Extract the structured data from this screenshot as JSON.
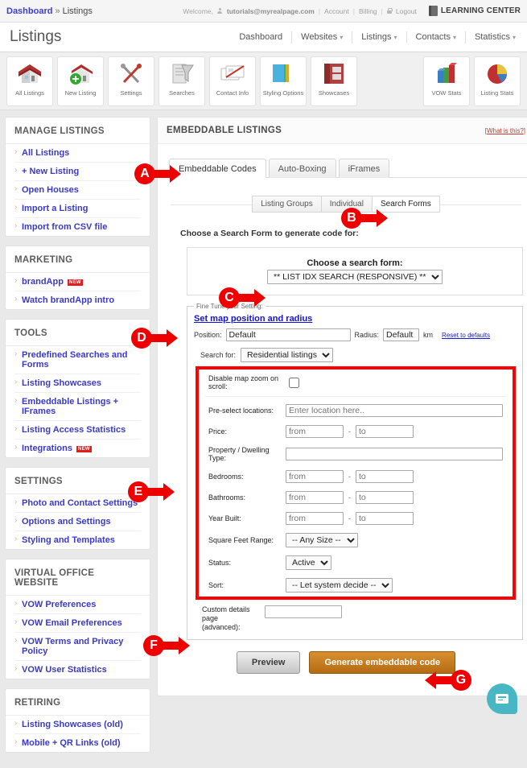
{
  "topbar": {
    "breadcrumb_link": "Dashboard",
    "breadcrumb_sep": "»",
    "breadcrumb_current": "Listings",
    "welcome_label": "Welcome,",
    "email": "tutorials@myrealpage.com",
    "account_link": "Account",
    "billing_link": "Billing",
    "logout_link": "Logout",
    "learning_center": "LEARNING CENTER",
    "divider": "|"
  },
  "titlebar": {
    "page_title": "Listings",
    "nav": [
      {
        "label": "Dashboard",
        "caret": ""
      },
      {
        "label": "Websites",
        "caret": "▾"
      },
      {
        "label": "Listings",
        "caret": "▾"
      },
      {
        "label": "Contacts",
        "caret": "▾"
      },
      {
        "label": "Statistics",
        "caret": "▾"
      }
    ]
  },
  "icontoolbar": {
    "left": [
      {
        "label": "All Listings",
        "icon": "house-icon"
      },
      {
        "label": "New Listing",
        "icon": "house-plus-icon"
      },
      {
        "label": "Settings",
        "icon": "tools-icon"
      },
      {
        "label": "Searches",
        "icon": "funnel-document-icon"
      },
      {
        "label": "Contact Info",
        "icon": "business-cards-icon"
      },
      {
        "label": "Styling Options",
        "icon": "color-books-icon"
      },
      {
        "label": "Showcases",
        "icon": "showcase-book-icon"
      }
    ],
    "right": [
      {
        "label": "VOW Stats",
        "icon": "bar-chart-icon"
      },
      {
        "label": "Listing Stats",
        "icon": "pie-chart-icon"
      }
    ]
  },
  "sidebar": {
    "sections": [
      {
        "title": "MANAGE LISTINGS",
        "items": [
          {
            "label": "All Listings",
            "new": false
          },
          {
            "label": "+ New Listing",
            "new": false
          },
          {
            "label": "Open Houses",
            "new": false
          },
          {
            "label": "Import a Listing",
            "new": false
          },
          {
            "label": "Import from CSV file",
            "new": false
          }
        ]
      },
      {
        "title": "MARKETING",
        "items": [
          {
            "label": "brandApp",
            "new": true,
            "new_label": "NEW"
          },
          {
            "label": "Watch brandApp intro",
            "new": false
          }
        ]
      },
      {
        "title": "TOOLS",
        "items": [
          {
            "label": "Predefined Searches and Forms",
            "new": false
          },
          {
            "label": "Listing Showcases",
            "new": false
          },
          {
            "label": "Embeddable Listings + IFrames",
            "new": false
          },
          {
            "label": "Listing Access Statistics",
            "new": false
          },
          {
            "label": "Integrations",
            "new": true,
            "new_label": "NEW"
          }
        ]
      },
      {
        "title": "SETTINGS",
        "items": [
          {
            "label": "Photo and Contact Settings",
            "new": false
          },
          {
            "label": "Options and Settings",
            "new": false
          },
          {
            "label": "Styling and Templates",
            "new": false
          }
        ]
      },
      {
        "title": "VIRTUAL OFFICE WEBSITE",
        "items": [
          {
            "label": "VOW Preferences",
            "new": false
          },
          {
            "label": "VOW Email Preferences",
            "new": false
          },
          {
            "label": "VOW Terms and Privacy Policy",
            "new": false
          },
          {
            "label": "VOW User Statistics",
            "new": false
          }
        ]
      },
      {
        "title": "RETIRING",
        "items": [
          {
            "label": "Listing Showcases (old)",
            "new": false
          },
          {
            "label": "Mobile + QR Links (old)",
            "new": false
          }
        ]
      }
    ]
  },
  "main": {
    "card_title": "EMBEDDABLE LISTINGS",
    "what_is_this": "[What is this?]",
    "tabs": [
      {
        "label": "Embeddable Codes",
        "active": true
      },
      {
        "label": "Auto-Boxing",
        "active": false
      },
      {
        "label": "iFrames",
        "active": false
      }
    ],
    "subtabs": [
      {
        "label": "Listing Groups",
        "active": false
      },
      {
        "label": "Individual",
        "active": false
      },
      {
        "label": "Search Forms",
        "active": true
      }
    ],
    "choose_label": "Choose a Search Form to generate code for:",
    "search_form_box": {
      "label": "Choose a search form:",
      "selected": "** LIST IDX SEARCH (RESPONSIVE) **"
    },
    "finetune": {
      "legend": "Fine Tune your Setting:",
      "set_map_link": "Set map position and radius",
      "position_label": "Position:",
      "position_value": "Default",
      "radius_label": "Radius:",
      "radius_value": "Default",
      "radius_unit": "km",
      "reset_link": "Reset to defaults",
      "search_for_label": "Search for:",
      "search_for_value": "Residential listings"
    },
    "fields": {
      "disable_zoom_label": "Disable map zoom on scroll:",
      "disable_zoom_checked": false,
      "rows": [
        {
          "label": "Pre-select locations:",
          "type": "text-wide",
          "placeholder": "Enter location here..",
          "value": ""
        },
        {
          "label": "Price:",
          "type": "range",
          "from_placeholder": "from",
          "to_placeholder": "to",
          "dash": "-"
        },
        {
          "label": "Property / Dwelling Type:",
          "type": "text-wide",
          "placeholder": "",
          "value": ""
        },
        {
          "label": "Bedrooms:",
          "type": "range",
          "from_placeholder": "from",
          "to_placeholder": "to",
          "dash": "-"
        },
        {
          "label": "Bathrooms:",
          "type": "range",
          "from_placeholder": "from",
          "to_placeholder": "to",
          "dash": "-"
        },
        {
          "label": "Year Built:",
          "type": "range",
          "from_placeholder": "from",
          "to_placeholder": "to",
          "dash": "-"
        },
        {
          "label": "Square Feet Range:",
          "type": "select",
          "value": "-- Any Size --"
        },
        {
          "label": "Status:",
          "type": "select",
          "value": "Active"
        },
        {
          "label": "Sort:",
          "type": "select",
          "value": "-- Let system decide --"
        }
      ]
    },
    "custom_details": {
      "label_line1": "Custom details page",
      "label_line2": "(advanced):",
      "value": ""
    },
    "buttons": {
      "preview": "Preview",
      "generate": "Generate embeddable code"
    }
  },
  "annotations": [
    {
      "letter": "A",
      "direction": "right"
    },
    {
      "letter": "B",
      "direction": "right"
    },
    {
      "letter": "C",
      "direction": "right"
    },
    {
      "letter": "D",
      "direction": "right"
    },
    {
      "letter": "E",
      "direction": "right"
    },
    {
      "letter": "F",
      "direction": "right"
    },
    {
      "letter": "G",
      "direction": "left"
    }
  ],
  "colors": {
    "annotation_red": "#ee0000",
    "link_blue": "#3a3ac6",
    "primary_button": "#b56b12",
    "chat_teal": "#49b6c4",
    "highlight_box": "#ff0000"
  },
  "chat": {
    "icon": "chat-bubble-icon"
  }
}
